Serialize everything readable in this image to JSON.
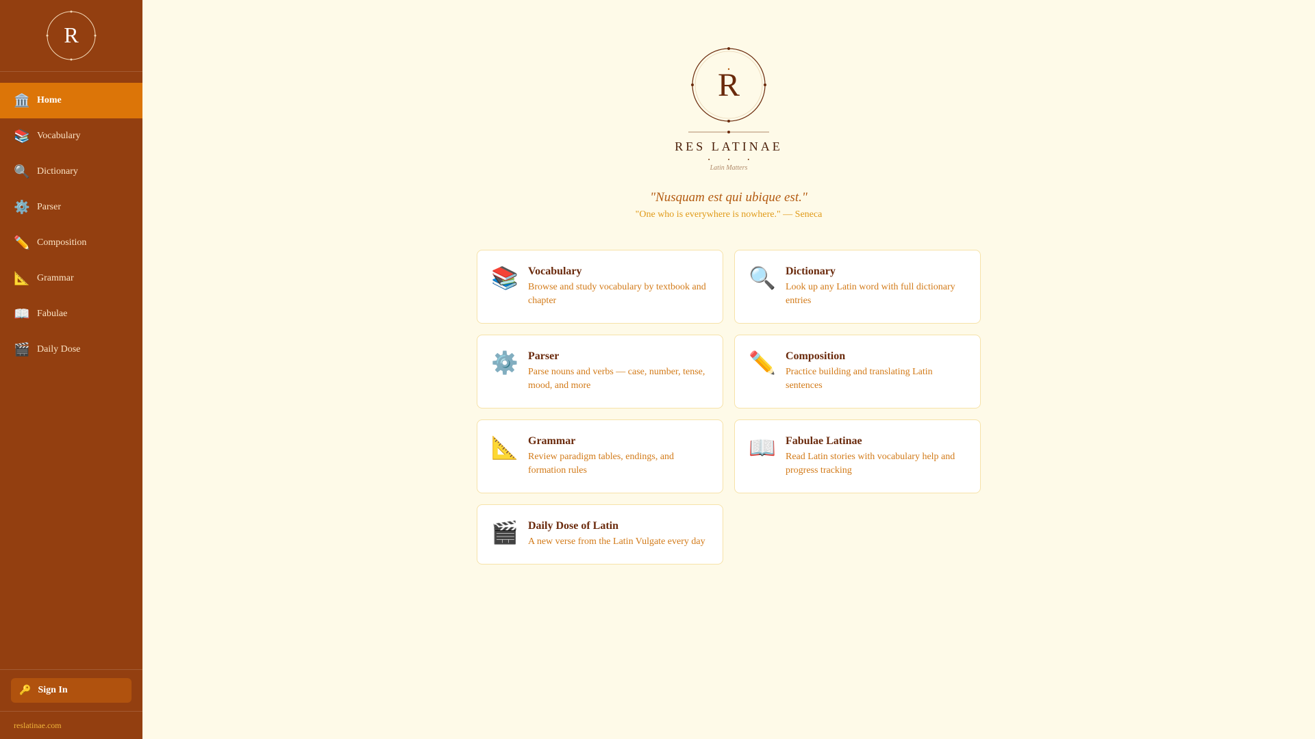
{
  "sidebar": {
    "logo_letter": "R",
    "items": [
      {
        "label": "Home",
        "icon": "🏛️",
        "icon_name": "temple-icon",
        "active": true
      },
      {
        "label": "Vocabulary",
        "icon": "📚",
        "icon_name": "books-icon"
      },
      {
        "label": "Dictionary",
        "icon": "🔍",
        "icon_name": "magnifier-icon"
      },
      {
        "label": "Parser",
        "icon": "⚙️",
        "icon_name": "gear-icon"
      },
      {
        "label": "Composition",
        "icon": "✏️",
        "icon_name": "pencil-icon"
      },
      {
        "label": "Grammar",
        "icon": "📐",
        "icon_name": "triangle-ruler-icon"
      },
      {
        "label": "Fabulae",
        "icon": "📖",
        "icon_name": "open-book-icon"
      },
      {
        "label": "Daily Dose",
        "icon": "🎬",
        "icon_name": "clapper-icon"
      }
    ],
    "signin": {
      "label": "Sign In",
      "icon": "🔑"
    },
    "footer": "reslatinae.com"
  },
  "brand": {
    "letter": "R",
    "title": "RES LATINAE",
    "subtitle": "Latin Matters"
  },
  "quote": {
    "latin": "\"Nusquam est qui ubique est.\"",
    "translation": "\"One who is everywhere is nowhere.\" — Seneca"
  },
  "cards": [
    {
      "title": "Vocabulary",
      "desc": "Browse and study vocabulary by textbook and chapter",
      "icon": "📚"
    },
    {
      "title": "Dictionary",
      "desc": "Look up any Latin word with full dictionary entries",
      "icon": "🔍"
    },
    {
      "title": "Parser",
      "desc": "Parse nouns and verbs — case, number, tense, mood, and more",
      "icon": "⚙️"
    },
    {
      "title": "Composition",
      "desc": "Practice building and translating Latin sentences",
      "icon": "✏️"
    },
    {
      "title": "Grammar",
      "desc": "Review paradigm tables, endings, and formation rules",
      "icon": "📐"
    },
    {
      "title": "Fabulae Latinae",
      "desc": "Read Latin stories with vocabulary help and progress tracking",
      "icon": "📖"
    },
    {
      "title": "Daily Dose of Latin",
      "desc": "A new verse from the Latin Vulgate every day",
      "icon": "🎬"
    }
  ],
  "colors": {
    "sidebar_bg": "#933f10",
    "active_item": "#dc7508",
    "page_bg": "#fefae8",
    "card_title": "#6a2a0c",
    "card_desc": "#d27a18"
  }
}
